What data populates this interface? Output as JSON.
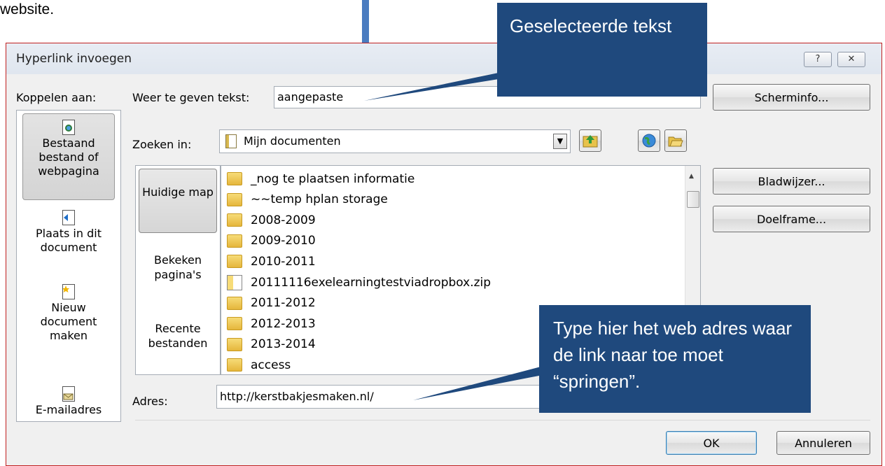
{
  "document": {
    "text_fragment": "website."
  },
  "dialog": {
    "title": "Hyperlink invoegen",
    "help_button": "?",
    "close_button": "✕",
    "link_to_label": "Koppelen aan:",
    "display_text_label": "Weer te geven tekst:",
    "display_text_value": "aangepaste",
    "screentip_button": "Scherminfo...",
    "look_in_label": "Zoeken in:",
    "look_in_value": "Mijn documenten",
    "link_to_items": [
      {
        "label": "Bestaand bestand of webpagina",
        "icon": "globe-document-icon",
        "selected": true
      },
      {
        "label": "Plaats in dit document",
        "icon": "document-place-icon",
        "selected": false
      },
      {
        "label": "Nieuw document maken",
        "icon": "new-document-icon",
        "selected": false
      },
      {
        "label": "E-mailadres",
        "icon": "email-icon",
        "selected": false
      }
    ],
    "nav_items": [
      {
        "label": "Huidige map",
        "selected": true
      },
      {
        "label": "Bekeken pagina's",
        "selected": false
      },
      {
        "label": "Recente bestanden",
        "selected": false
      }
    ],
    "files": [
      {
        "name": "_nog te plaatsen informatie",
        "type": "folder"
      },
      {
        "name": "~~temp hplan storage",
        "type": "folder"
      },
      {
        "name": "2008-2009",
        "type": "folder"
      },
      {
        "name": "2009-2010",
        "type": "folder"
      },
      {
        "name": "2010-2011",
        "type": "folder"
      },
      {
        "name": "20111116exelearningtestviadropbox.zip",
        "type": "zip"
      },
      {
        "name": "2011-2012",
        "type": "folder"
      },
      {
        "name": "2012-2013",
        "type": "folder"
      },
      {
        "name": "2013-2014",
        "type": "folder"
      },
      {
        "name": "access",
        "type": "folder"
      }
    ],
    "bookmark_button": "Bladwijzer...",
    "target_frame_button": "Doelframe...",
    "address_label": "Adres:",
    "address_value": "http://kerstbakjesmaken.nl/",
    "ok_button": "OK",
    "cancel_button": "Annuleren"
  },
  "callouts": {
    "selected_text": "Geselecteerde tekst",
    "address_hint": "Type hier het web adres waar de link naar toe moet “springen”."
  },
  "colors": {
    "callout": "#1f497d",
    "arrow": "#4a7cc0",
    "dialog_bg": "#f0f0f0",
    "dialog_border": "#c02020"
  }
}
